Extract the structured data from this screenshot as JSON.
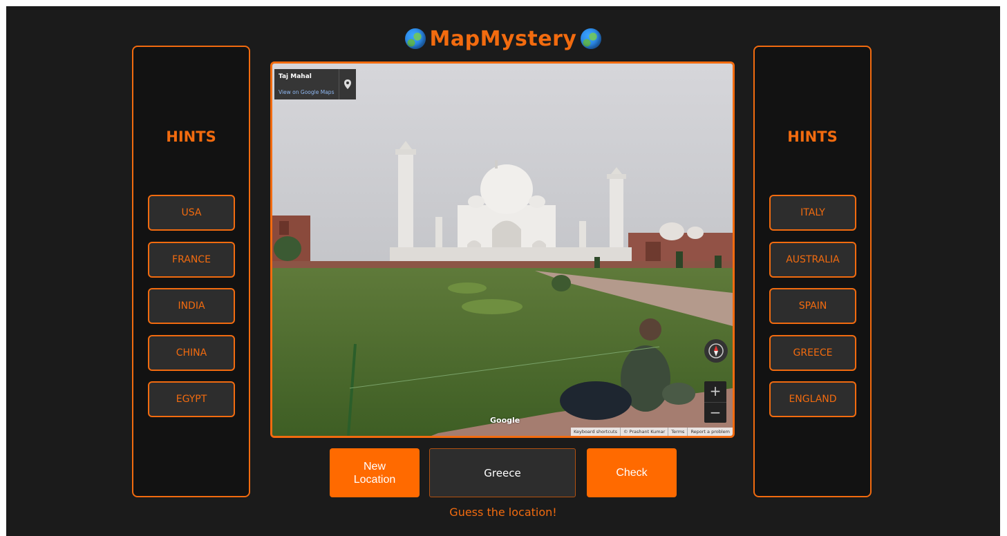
{
  "app": {
    "title": "MapMystery"
  },
  "left_panel": {
    "heading": "HINTS",
    "hints": [
      "USA",
      "FRANCE",
      "INDIA",
      "CHINA",
      "EGYPT"
    ]
  },
  "right_panel": {
    "heading": "HINTS",
    "hints": [
      "ITALY",
      "AUSTRALIA",
      "SPAIN",
      "GREECE",
      "ENGLAND"
    ]
  },
  "street_view": {
    "place_name": "Taj Mahal",
    "maps_link": "View on Google Maps",
    "logo_text": "Google",
    "attribution": [
      "Keyboard shortcuts",
      "© Prashant Kumar",
      "Terms",
      "Report a problem"
    ],
    "zoom_in": "+",
    "zoom_out": "−"
  },
  "controls": {
    "new_location_label": "New Location",
    "guess_value": "Greece",
    "check_label": "Check"
  },
  "status": {
    "message": "Guess the location!"
  },
  "colors": {
    "accent": "#f26b0f",
    "button": "#ff6a00",
    "background": "#1b1b1b",
    "panel": "#121212",
    "hint_button": "#2d2d2d"
  }
}
